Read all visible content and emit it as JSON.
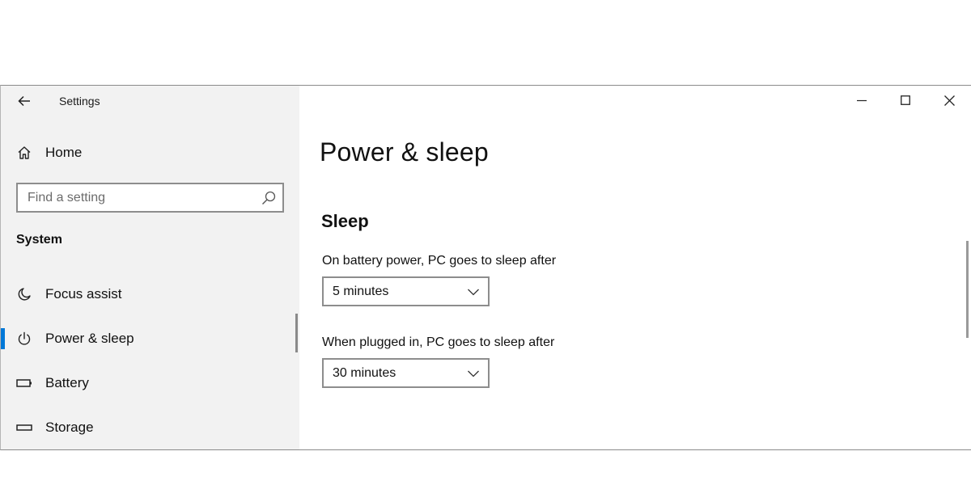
{
  "window": {
    "title": "Settings",
    "controls": {
      "minimize": "minimize-icon",
      "maximize": "maximize-icon",
      "close": "close-icon"
    }
  },
  "sidebar": {
    "home_label": "Home",
    "search": {
      "placeholder": "Find a setting",
      "value": ""
    },
    "section_label": "System",
    "items": [
      {
        "label": "Focus assist",
        "icon": "moon-icon",
        "active": false
      },
      {
        "label": "Power & sleep",
        "icon": "power-icon",
        "active": true
      },
      {
        "label": "Battery",
        "icon": "battery-icon",
        "active": false
      },
      {
        "label": "Storage",
        "icon": "storage-icon",
        "active": false
      }
    ]
  },
  "main": {
    "page_title": "Power & sleep",
    "sleep": {
      "heading": "Sleep",
      "battery_label": "On battery power, PC goes to sleep after",
      "battery_value": "5 minutes",
      "plugged_label": "When plugged in, PC goes to sleep after",
      "plugged_value": "30 minutes"
    }
  },
  "colors": {
    "accent": "#0078d7",
    "sidebar_bg": "#f2f2f2",
    "content_bg": "#ffffff",
    "border": "#8d8d8d"
  }
}
